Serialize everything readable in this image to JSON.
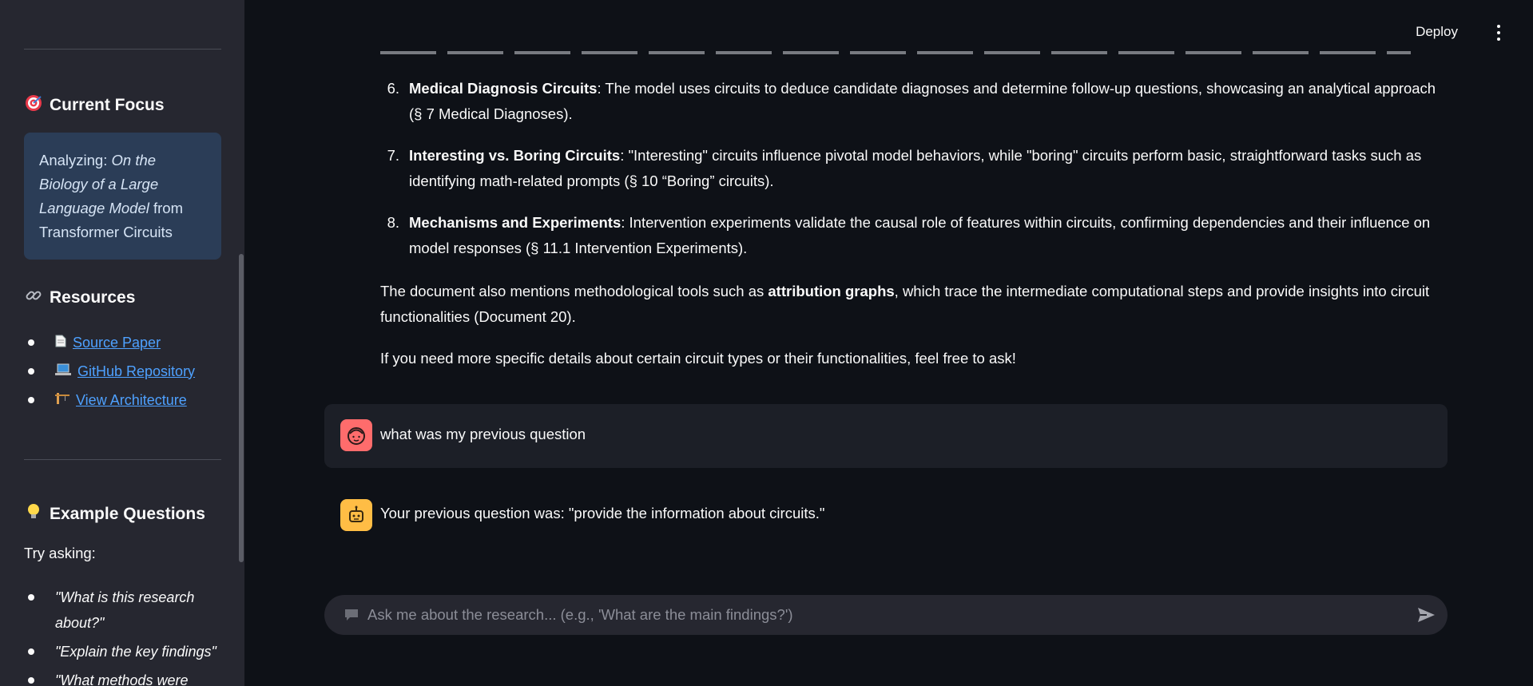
{
  "sidebar": {
    "focus_heading": "Current Focus",
    "focus_prefix": "Analyzing: ",
    "focus_title": "On the Biology of a Large Language Model",
    "focus_suffix": " from Transformer Circuits",
    "resources_heading": "Resources",
    "resources": [
      {
        "icon": "page-icon",
        "label": "Source Paper"
      },
      {
        "icon": "laptop-icon",
        "label": "GitHub Repository"
      },
      {
        "icon": "architecture-icon",
        "label": "View Architecture"
      }
    ],
    "examples_heading": "Example Questions",
    "try_asking": "Try asking:",
    "questions": [
      "\"What is this research about?\"",
      "\"Explain the key findings\"",
      "\"What methods were"
    ]
  },
  "header": {
    "deploy_label": "Deploy"
  },
  "assistant_answer": {
    "items": [
      {
        "num": "6.",
        "bold": "Medical Diagnosis Circuits",
        "rest": ": The model uses circuits to deduce candidate diagnoses and determine follow-up questions, showcasing an analytical approach (§ 7 Medical Diagnoses)."
      },
      {
        "num": "7.",
        "bold": "Interesting vs. Boring Circuits",
        "rest": ": \"Interesting\" circuits influence pivotal model behaviors, while \"boring\" circuits perform basic, straightforward tasks such as identifying math-related prompts (§ 10 “Boring” circuits)."
      },
      {
        "num": "8.",
        "bold": "Mechanisms and Experiments",
        "rest": ": Intervention experiments validate the causal role of features within circuits, confirming dependencies and their influence on model responses (§ 11.1 Intervention Experiments)."
      }
    ],
    "para1_a": "The document also mentions methodological tools such as ",
    "para1_bold": "attribution graphs",
    "para1_b": ", which trace the intermediate computational steps and provide insights into circuit functionalities (Document 20).",
    "para2": "If you need more specific details about certain circuit types or their functionalities, feel free to ask!"
  },
  "chat": {
    "user_message": "what was my previous question",
    "bot_message": "Your previous question was: \"provide the information about circuits.\""
  },
  "input": {
    "placeholder": "Ask me about the research... (e.g., 'What are the main findings?')"
  }
}
